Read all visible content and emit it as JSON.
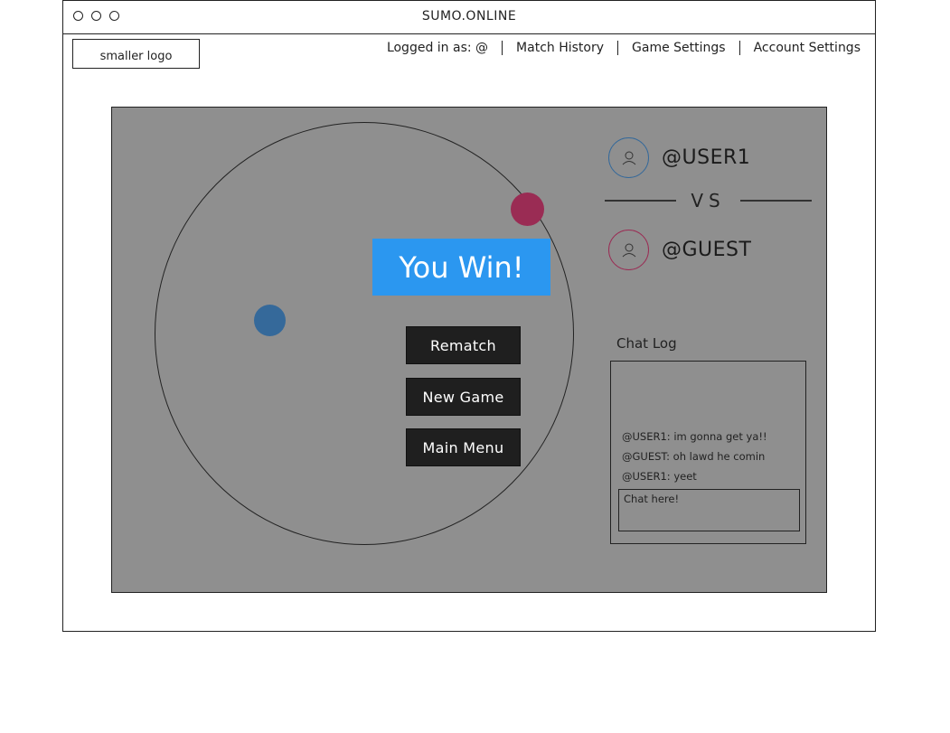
{
  "window": {
    "title": "SUMO.ONLINE"
  },
  "header": {
    "logo_text": "smaller logo",
    "logged_in_label": "Logged in as: @",
    "nav": [
      "Match History",
      "Game Settings",
      "Account Settings"
    ]
  },
  "game": {
    "result_text": "You Win!",
    "buttons": [
      "Rematch",
      "New Game",
      "Main Menu"
    ]
  },
  "players": {
    "player1": "@USER1",
    "versus": "VS",
    "player2": "@GUEST"
  },
  "chat": {
    "label": "Chat Log",
    "messages": [
      "@USER1: im gonna get ya!!",
      "@GUEST: oh lawd he comin",
      "@USER1: yeet"
    ],
    "input_placeholder": "Chat here!"
  },
  "colors": {
    "accent": "#2b97f0",
    "player1": "#35699a",
    "player2": "#9a2c54",
    "game_bg": "#8f8f8f"
  }
}
